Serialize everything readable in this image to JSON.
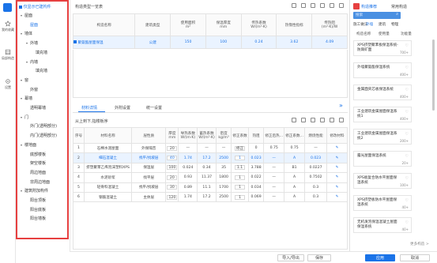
{
  "rail": [
    {
      "label": "我的收藏",
      "icon": "star-icon"
    },
    {
      "label": "局部构造",
      "icon": "layers-icon"
    },
    {
      "label": "设置",
      "icon": "gear-icon"
    }
  ],
  "tree": {
    "show_built_label": "仅显示已建构件",
    "items": [
      {
        "label": "屋面",
        "indent": 0,
        "caret": "▾"
      },
      {
        "label": "屋面",
        "indent": 1,
        "caret": "",
        "selected": true
      },
      {
        "label": "墙体",
        "indent": 0,
        "caret": "▾"
      },
      {
        "label": "外墙",
        "indent": 1,
        "caret": "▾"
      },
      {
        "label": "填充墙",
        "indent": 2,
        "caret": ""
      },
      {
        "label": "内墙",
        "indent": 1,
        "caret": "▾"
      },
      {
        "label": "填充墙",
        "indent": 2,
        "caret": ""
      },
      {
        "label": "窗",
        "indent": 0,
        "caret": "▾"
      },
      {
        "label": "外窗",
        "indent": 1,
        "caret": ""
      },
      {
        "label": "幕墙",
        "indent": 0,
        "caret": "▾"
      },
      {
        "label": "透明幕墙",
        "indent": 1,
        "caret": ""
      },
      {
        "label": "门",
        "indent": 0,
        "caret": "▾"
      },
      {
        "label": "外门(透明部分)",
        "indent": 1,
        "caret": ""
      },
      {
        "label": "内门(透明部分)",
        "indent": 1,
        "caret": ""
      },
      {
        "label": "楼地面",
        "indent": 0,
        "caret": "▾"
      },
      {
        "label": "底部楼板",
        "indent": 1,
        "caret": ""
      },
      {
        "label": "架空楼板",
        "indent": 1,
        "caret": ""
      },
      {
        "label": "周边地面",
        "indent": 1,
        "caret": ""
      },
      {
        "label": "非周边地面",
        "indent": 1,
        "caret": ""
      },
      {
        "label": "建筑附加构件",
        "indent": 0,
        "caret": "▾"
      },
      {
        "label": "阳台顶板",
        "indent": 1,
        "caret": ""
      },
      {
        "label": "阳台底板",
        "indent": 1,
        "caret": ""
      },
      {
        "label": "阳台墙板",
        "indent": 1,
        "caret": ""
      }
    ]
  },
  "list_panel": {
    "title": "构造类型一览表",
    "headers": [
      "构造名称",
      "建筑类型",
      "使用面积\nm²",
      "保温厚度\nmm",
      "传热系数\nW/(m²·K)",
      "热惰性指标",
      "传热阻\n(m²·K)/W"
    ],
    "row": {
      "name": "聚氨酯屋面保温",
      "type": "公建",
      "area": "150",
      "thickness": "100",
      "k": "0.24",
      "d": "3.62",
      "r": "4.09"
    }
  },
  "detail_tabs": [
    "材料详情",
    "外附设置",
    "统一设置"
  ],
  "detail": {
    "order_label": "从上到下,指楼板序",
    "headers": [
      "序号",
      "材料名称",
      "层性质",
      "厚度\nmm",
      "导热系数\nW/(m·K)",
      "蓄热系数\nW/(m²·K)",
      "密度\nkg/m³",
      "修正系数",
      "热阻",
      "修正后热...",
      "修正系数...",
      "燃烧性能",
      "修改材料"
    ],
    "rows": [
      {
        "no": "1",
        "name": "石棉水泥屋面",
        "prop": "外保隔音",
        "t": "20",
        "lam": "—",
        "s": "—",
        "rho": "—",
        "cf": "修正",
        "r": "0",
        "rc": "0.75",
        "c2": "0.75",
        "fire": "—",
        "blue": false
      },
      {
        "no": "2",
        "name": "细石混凝土",
        "prop": "找平/找坡层",
        "t": "40",
        "lam": "1.74",
        "s": "17.2",
        "rho": "2500",
        "cf": "1",
        "r": "0.023",
        "rc": "—",
        "c2": "A",
        "fire": "0.023",
        "blue": true
      },
      {
        "no": "3",
        "name": "挤塑聚苯乙烯泡沫塑料XPS",
        "prop": "保温层",
        "t": "100",
        "lam": "0.024",
        "s": "0.34",
        "rho": "35",
        "cf": "1.1",
        "r": "3.788",
        "rc": "—",
        "c2": "B1",
        "fire": "0.0227",
        "blue": false
      },
      {
        "no": "4",
        "name": "水泥砂浆",
        "prop": "找平层",
        "t": "20",
        "lam": "0.93",
        "s": "11.37",
        "rho": "1800",
        "cf": "1",
        "r": "0.022",
        "rc": "—",
        "c2": "A",
        "fire": "0.7502",
        "blue": false
      },
      {
        "no": "5",
        "name": "轻骨料混凝土",
        "prop": "找平/找坡层",
        "t": "30",
        "lam": "0.89",
        "s": "11.1",
        "rho": "1700",
        "cf": "1",
        "r": "0.034",
        "rc": "—",
        "c2": "A",
        "fire": "0.3",
        "blue": false
      },
      {
        "no": "6",
        "name": "钢筋混凝土",
        "prop": "主体层",
        "t": "120",
        "lam": "1.74",
        "s": "17.2",
        "rho": "2500",
        "cf": "1",
        "r": "0.069",
        "rc": "—",
        "c2": "A",
        "fire": "0.3",
        "blue": false
      }
    ]
  },
  "right_panel": {
    "tabs": [
      "构造推荐",
      "常用构造"
    ],
    "search_placeholder": "搜索",
    "filter_tabs": [
      "施工做法",
      "外墙",
      "建筑",
      "物理"
    ],
    "sort": [
      "构造名称",
      "使用量",
      "功能量"
    ],
    "cards": [
      {
        "title": "XPS挤塑聚苯板保温系统-防腐矿面",
        "meta": "700+"
      },
      {
        "title": "外墙聚氨酯保温系统",
        "meta": "400+"
      },
      {
        "title": "金属面夹芯板保温系统",
        "meta": "400+"
      },
      {
        "title": "工业建筑金属屋面保温系统1",
        "meta": "400+"
      },
      {
        "title": "工业建筑金属屋面保温系统2",
        "meta": "200+"
      },
      {
        "title": "露光屋面保温系统",
        "meta": "20+"
      },
      {
        "title": "XPS板复合防水平屋面保温系统",
        "meta": "100+"
      },
      {
        "title": "XPS挤塑板防水平屋面保温系统",
        "meta": "40+"
      },
      {
        "title": "无机发泡保温混凝土屋面保温系统",
        "meta": "40+"
      }
    ],
    "more": "更多构造 >",
    "fav_symbol": "♡"
  },
  "bottom": {
    "import": "导入/导出",
    "save": "保存",
    "apply": "应用",
    "cancel": "取消"
  },
  "colors": {
    "accent": "#1a73e8",
    "highlight": "#e64040"
  }
}
